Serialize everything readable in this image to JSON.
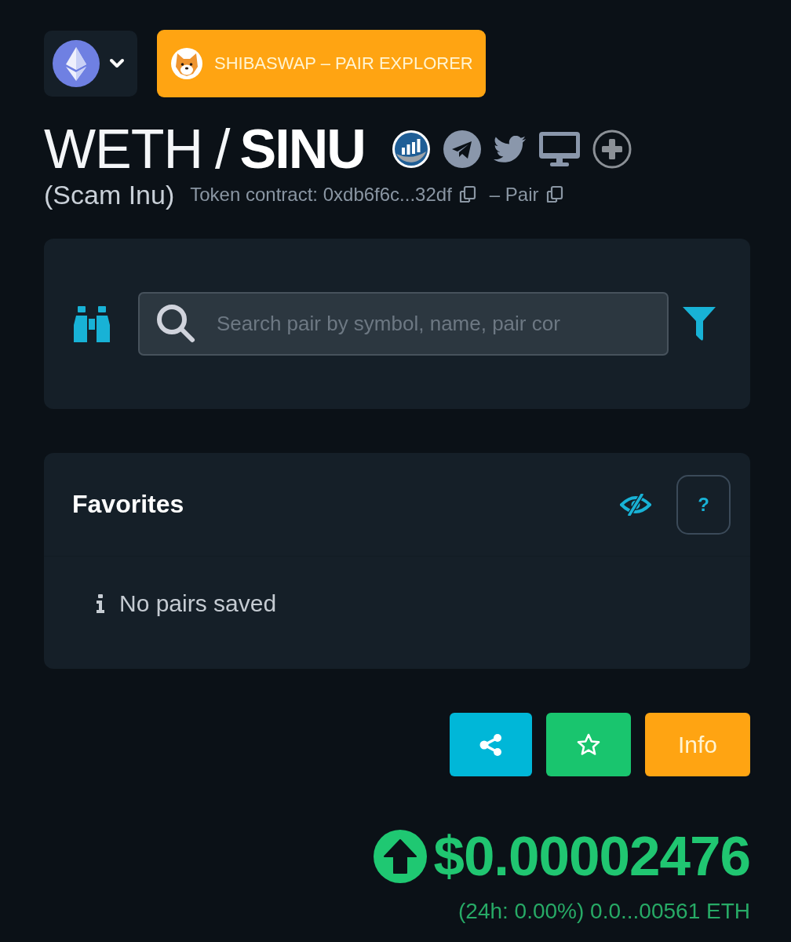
{
  "explorer_button": {
    "label": "SHIBASWAP – PAIR EXPLORER"
  },
  "pair": {
    "base": "WETH",
    "separator": "/",
    "quote": "SINU",
    "token_name": "(Scam Inu)",
    "contract": "Token contract: 0xdb6f6c...32df",
    "pair_link": "– Pair"
  },
  "links": [
    {
      "kind": "chart"
    },
    {
      "kind": "telegram"
    },
    {
      "kind": "twitter"
    },
    {
      "kind": "website"
    },
    {
      "kind": "add"
    }
  ],
  "search": {
    "placeholder": "Search pair by symbol, name, pair cor"
  },
  "favorites": {
    "title": "Favorites",
    "help": "?",
    "empty_message": "No pairs saved"
  },
  "actions": [
    {
      "kind": "share"
    },
    {
      "kind": "favorite"
    },
    {
      "kind": "info",
      "label": "Info"
    }
  ],
  "price": {
    "rising": true,
    "value": "$0.00002476",
    "change": "(24h: 0.00%) 0.0...00561 ETH"
  }
}
